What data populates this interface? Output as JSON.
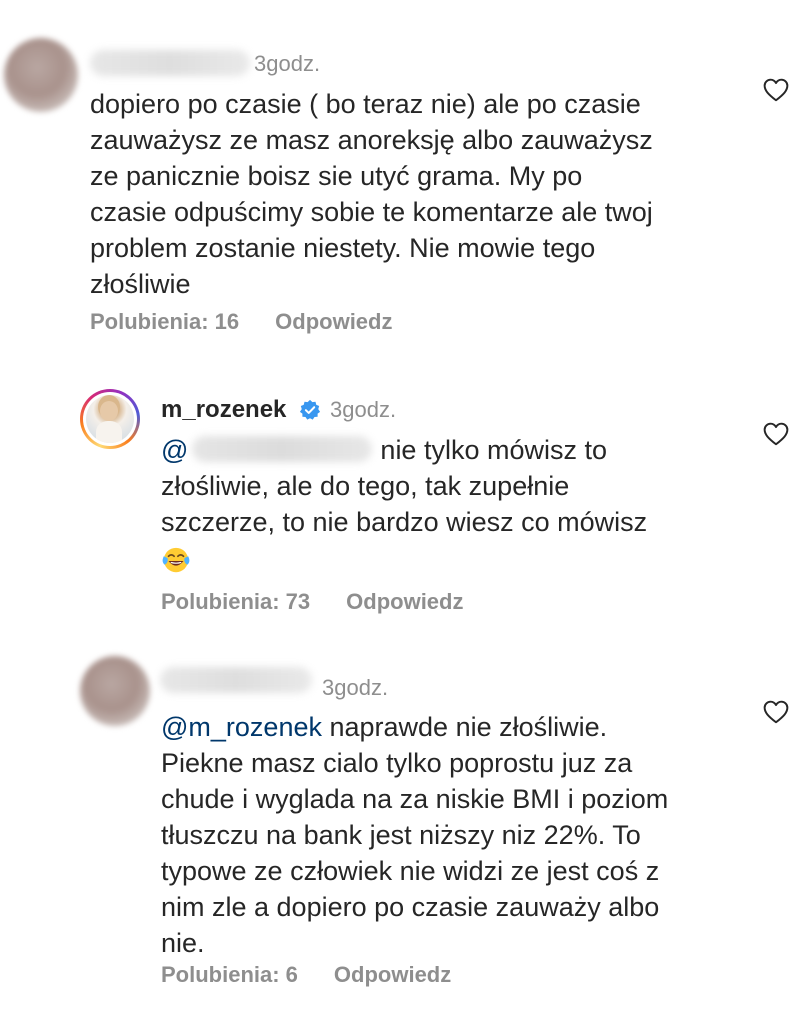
{
  "comments": [
    {
      "time": "3godz.",
      "lines": [
        "dopiero po czasie ( bo teraz nie) ale po czasie",
        "zauważysz ze masz anoreksję albo zauważysz",
        "ze panicznie boisz sie utyć grama. My po",
        "czasie odpuścimy sobie te komentarze ale twoj",
        "problem zostanie niestety. Nie mowie tego",
        "złośliwie"
      ],
      "likes": "Polubienia: 16",
      "reply": "Odpowiedz"
    },
    {
      "username": "m_rozenek",
      "time": "3godz.",
      "mention_prefix": "@",
      "first_line_rest": "nie tylko mówisz to",
      "lines": [
        "złośliwie, ale do tego, tak zupełnie",
        "szczerze, to nie bardzo wiesz co mówisz"
      ],
      "emoji": "face-with-tears-of-joy",
      "likes": "Polubienia: 73",
      "reply": "Odpowiedz"
    },
    {
      "time": "3godz.",
      "mention": "@m_rozenek",
      "first_line_rest": " naprawde nie złośliwie.",
      "lines": [
        "Piekne masz cialo tylko poprostu juz za",
        "chude i wyglada na za niskie BMI i poziom",
        "tłuszczu na bank jest niższy niz 22%. To",
        "typowe ze człowiek nie widzi ze jest coś z",
        "nim zle a dopiero po czasie zauważy albo",
        "nie."
      ],
      "likes": "Polubienia: 6",
      "reply": "Odpowiedz"
    }
  ],
  "colors": {
    "text": "#262626",
    "secondary": "#8e8e8e",
    "mention": "#00376b",
    "verified": "#3897f0"
  },
  "icons": {
    "like": "heart-outline-icon",
    "verified": "verified-badge-icon"
  }
}
